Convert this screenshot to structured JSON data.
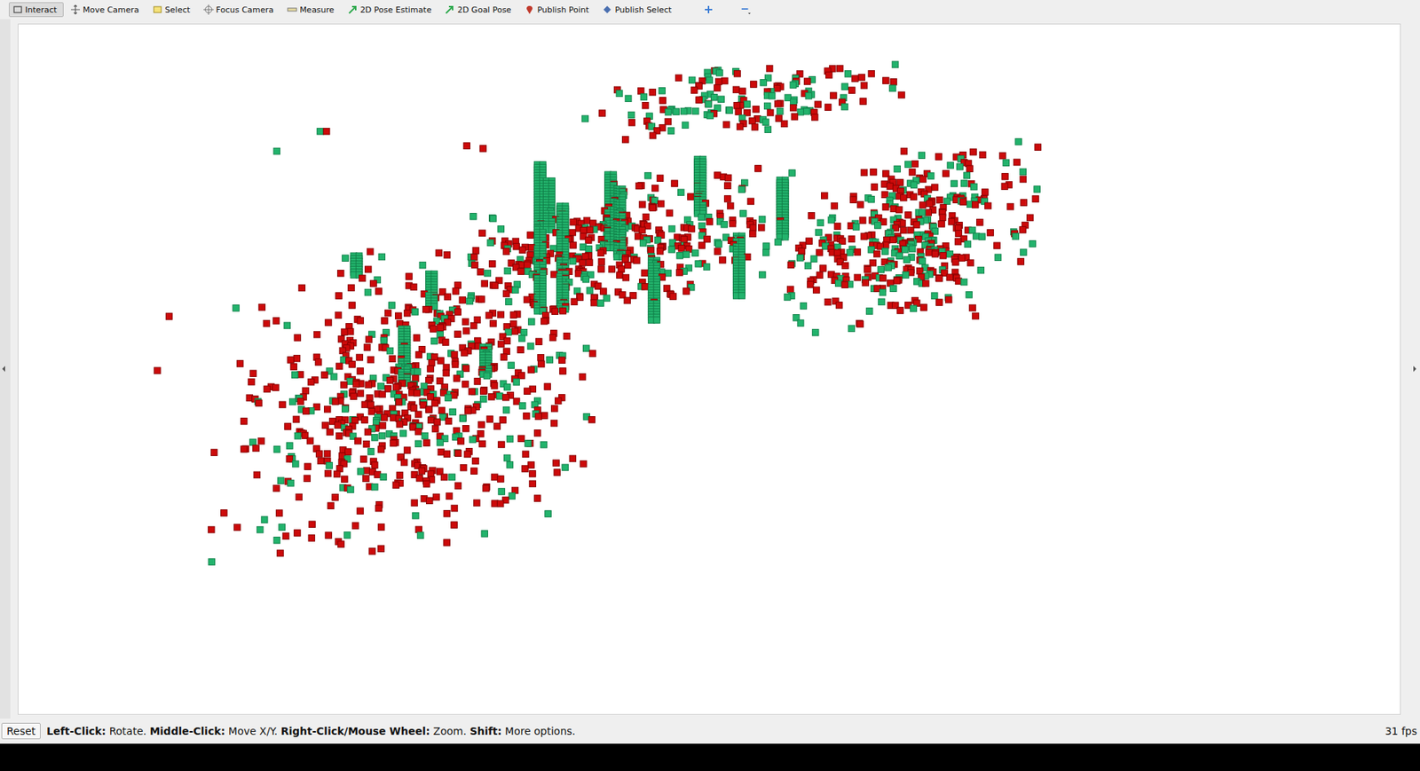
{
  "toolbar": {
    "tools": [
      {
        "label": "Interact",
        "selected": true
      },
      {
        "label": "Move Camera",
        "selected": false
      },
      {
        "label": "Select",
        "selected": false
      },
      {
        "label": "Focus Camera",
        "selected": false
      },
      {
        "label": "Measure",
        "selected": false
      },
      {
        "label": "2D Pose Estimate",
        "selected": false
      },
      {
        "label": "2D Goal Pose",
        "selected": false
      },
      {
        "label": "Publish Point",
        "selected": false
      },
      {
        "label": "Publish Select",
        "selected": false
      }
    ]
  },
  "status_bar": {
    "reset": "Reset",
    "hint": [
      {
        "text": "Left-Click:",
        "bold": true
      },
      {
        "text": " Rotate. ",
        "bold": false
      },
      {
        "text": "Middle-Click:",
        "bold": true
      },
      {
        "text": " Move X/Y. ",
        "bold": false
      },
      {
        "text": "Right-Click/Mouse Wheel:",
        "bold": true
      },
      {
        "text": " Zoom. ",
        "bold": false
      },
      {
        "text": "Shift:",
        "bold": true
      },
      {
        "text": " More options.",
        "bold": false
      }
    ],
    "fps": "31 fps"
  }
}
